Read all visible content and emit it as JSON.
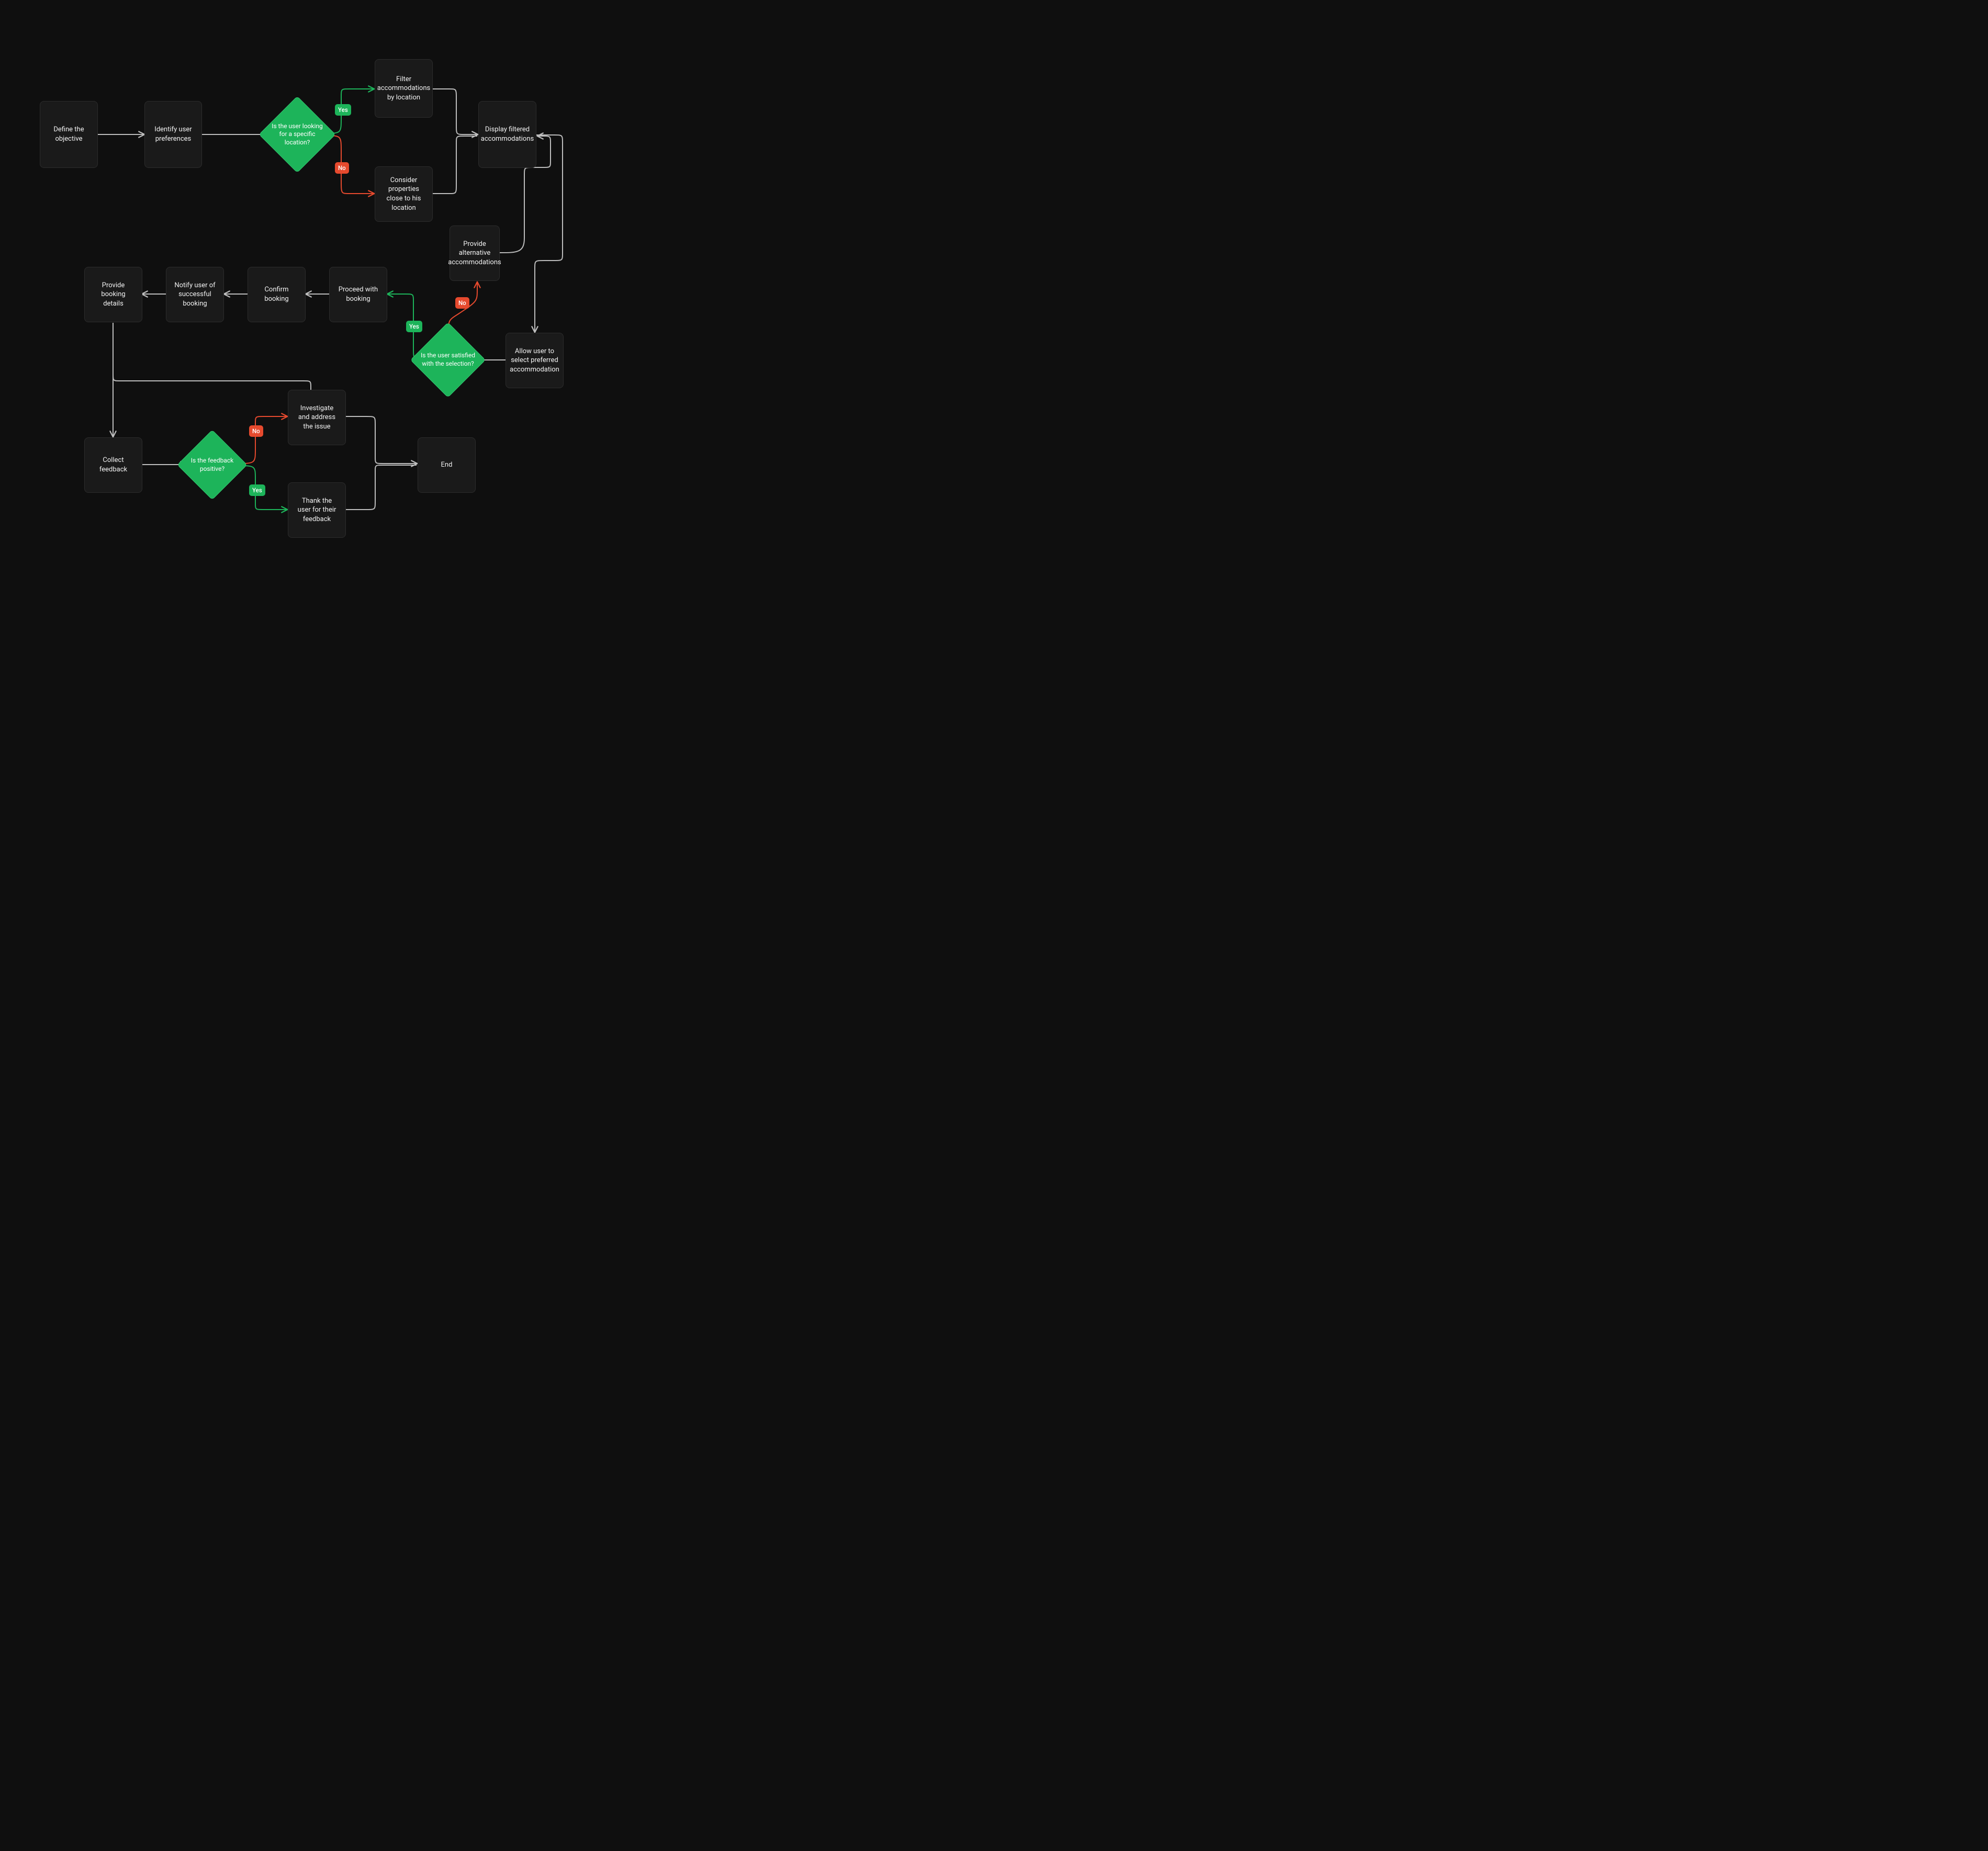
{
  "colors": {
    "bg": "#0f0f0f",
    "node_bg": "#1a1a1a",
    "node_border": "#2c2c2c",
    "text": "#f2f2f2",
    "edge_gray": "#bdbdbd",
    "green": "#1db45a",
    "green_border": "#34c46f",
    "red": "#e64a2e"
  },
  "badges": {
    "yes": "Yes",
    "no": "No"
  },
  "nodes": {
    "define_objective": "Define the objective",
    "identify_prefs": "Identify user preferences",
    "decision_location": "Is the user looking for a specific location?",
    "filter_by_location": "Filter accommodations by location",
    "consider_nearby": "Consider properties close to his location",
    "display_filtered": "Display filtered accommodations",
    "provide_alternatives": "Provide alternative accommodations",
    "allow_select": "Allow user to select preferred accommodation",
    "decision_satisfied": "Is the user satisfied with the selection?",
    "proceed_booking": "Proceed with booking",
    "confirm_booking": "Confirm booking",
    "notify_success": "Notify user of successful booking",
    "provide_booking_details": "Provide booking details",
    "collect_feedback": "Collect feedback",
    "decision_feedback": "Is the feedback positive?",
    "investigate_issue": "Investigate and address the issue",
    "thank_user": "Thank the user for their feedback",
    "end": "End"
  }
}
